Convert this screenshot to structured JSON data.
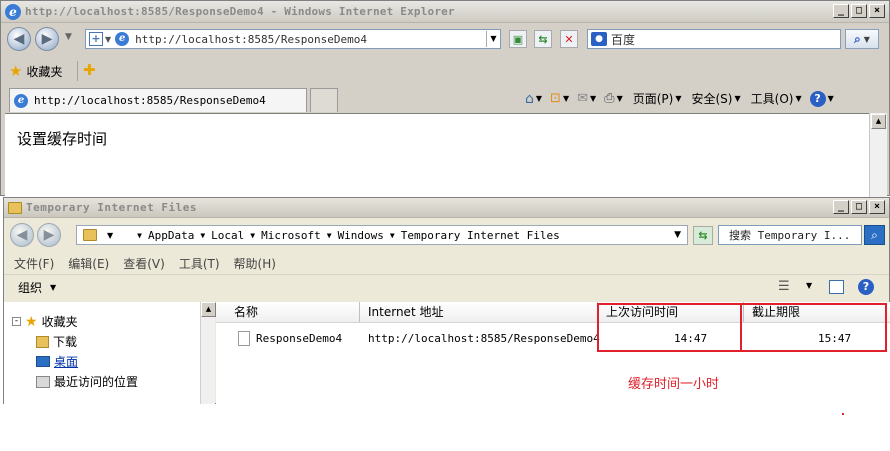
{
  "ie": {
    "title": "http://localhost:8585/ResponseDemo4 - Windows Internet Explorer",
    "address": "http://localhost:8585/ResponseDemo4",
    "search_placeholder": "百度",
    "favorites_label": "收藏夹",
    "tab_title": "http://localhost:8585/ResponseDemo4",
    "commands": {
      "page": "页面(P)",
      "safety": "安全(S)",
      "tools": "工具(O)"
    },
    "page_text": "设置缓存时间"
  },
  "explorer": {
    "title": "Temporary Internet Files",
    "breadcrumb": [
      "AppData",
      "Local",
      "Microsoft",
      "Windows",
      "Temporary Internet Files"
    ],
    "search_placeholder": "搜索 Temporary I...",
    "menu": [
      "文件(F)",
      "编辑(E)",
      "查看(V)",
      "工具(T)",
      "帮助(H)"
    ],
    "organize_label": "组织",
    "tree": {
      "favorites": "收藏夹",
      "downloads": "下载",
      "desktop": "桌面",
      "recent": "最近访问的位置"
    },
    "columns": [
      "名称",
      "Internet 地址",
      "上次访问时间",
      "截止期限"
    ],
    "rows": [
      {
        "name": "ResponseDemo4",
        "url": "http://localhost:8585/ResponseDemo4",
        "last_access": "14:47",
        "expires": "15:47"
      }
    ]
  },
  "annotation": {
    "text": "缓存时间一小时",
    "color": "#e0202a"
  }
}
